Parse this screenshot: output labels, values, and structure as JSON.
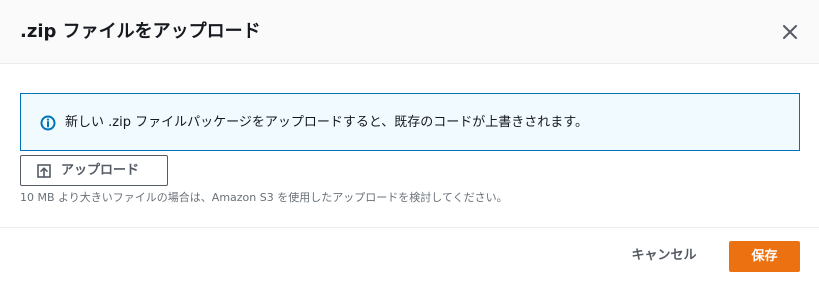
{
  "modal": {
    "title": ".zip ファイルをアップロード",
    "close_icon": "close-icon"
  },
  "info_alert": {
    "icon": "info-icon",
    "text": "新しい .zip ファイルパッケージをアップロードすると、既存のコードが上書きされます。",
    "border_color": "#0073bb",
    "background_color": "#f1faff"
  },
  "upload": {
    "icon": "upload-icon",
    "label": "アップロード",
    "hint": "10 MB より大きいファイルの場合は、Amazon S3 を使用したアップロードを検討してください。"
  },
  "footer": {
    "cancel_label": "キャンセル",
    "save_label": "保存",
    "save_color": "#ec7211"
  }
}
